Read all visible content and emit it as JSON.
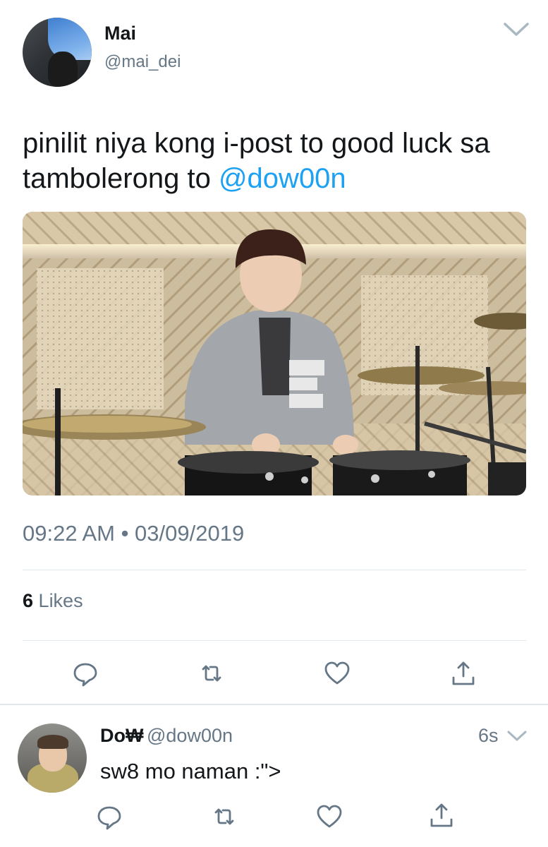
{
  "tweet": {
    "author": {
      "display_name": "Mai",
      "handle": "@mai_dei",
      "avatar_icon": "user-avatar"
    },
    "menu_icon": "chevron-down-icon",
    "text_main": "pinilit niya kong i-post to good luck sa tambolerong to ",
    "mention": "@dow00n",
    "media_icon": "drummer-photo",
    "timestamp": "09:22 AM • 03/09/2019",
    "likes_count": "6",
    "likes_label": "Likes",
    "actions": [
      "reply-icon",
      "retweet-icon",
      "like-icon",
      "share-icon"
    ]
  },
  "reply": {
    "author": {
      "display_name": "Do₩",
      "handle": "@dow00n",
      "avatar_icon": "user-avatar"
    },
    "time": "6s",
    "text": "sw8 mo naman :\">",
    "actions": [
      "reply-icon",
      "retweet-icon",
      "like-icon",
      "share-icon"
    ]
  },
  "colors": {
    "text": "#14171a",
    "secondary": "#657786",
    "link": "#1da1f2",
    "divider": "#e1e8ed",
    "icon": "#657786"
  }
}
